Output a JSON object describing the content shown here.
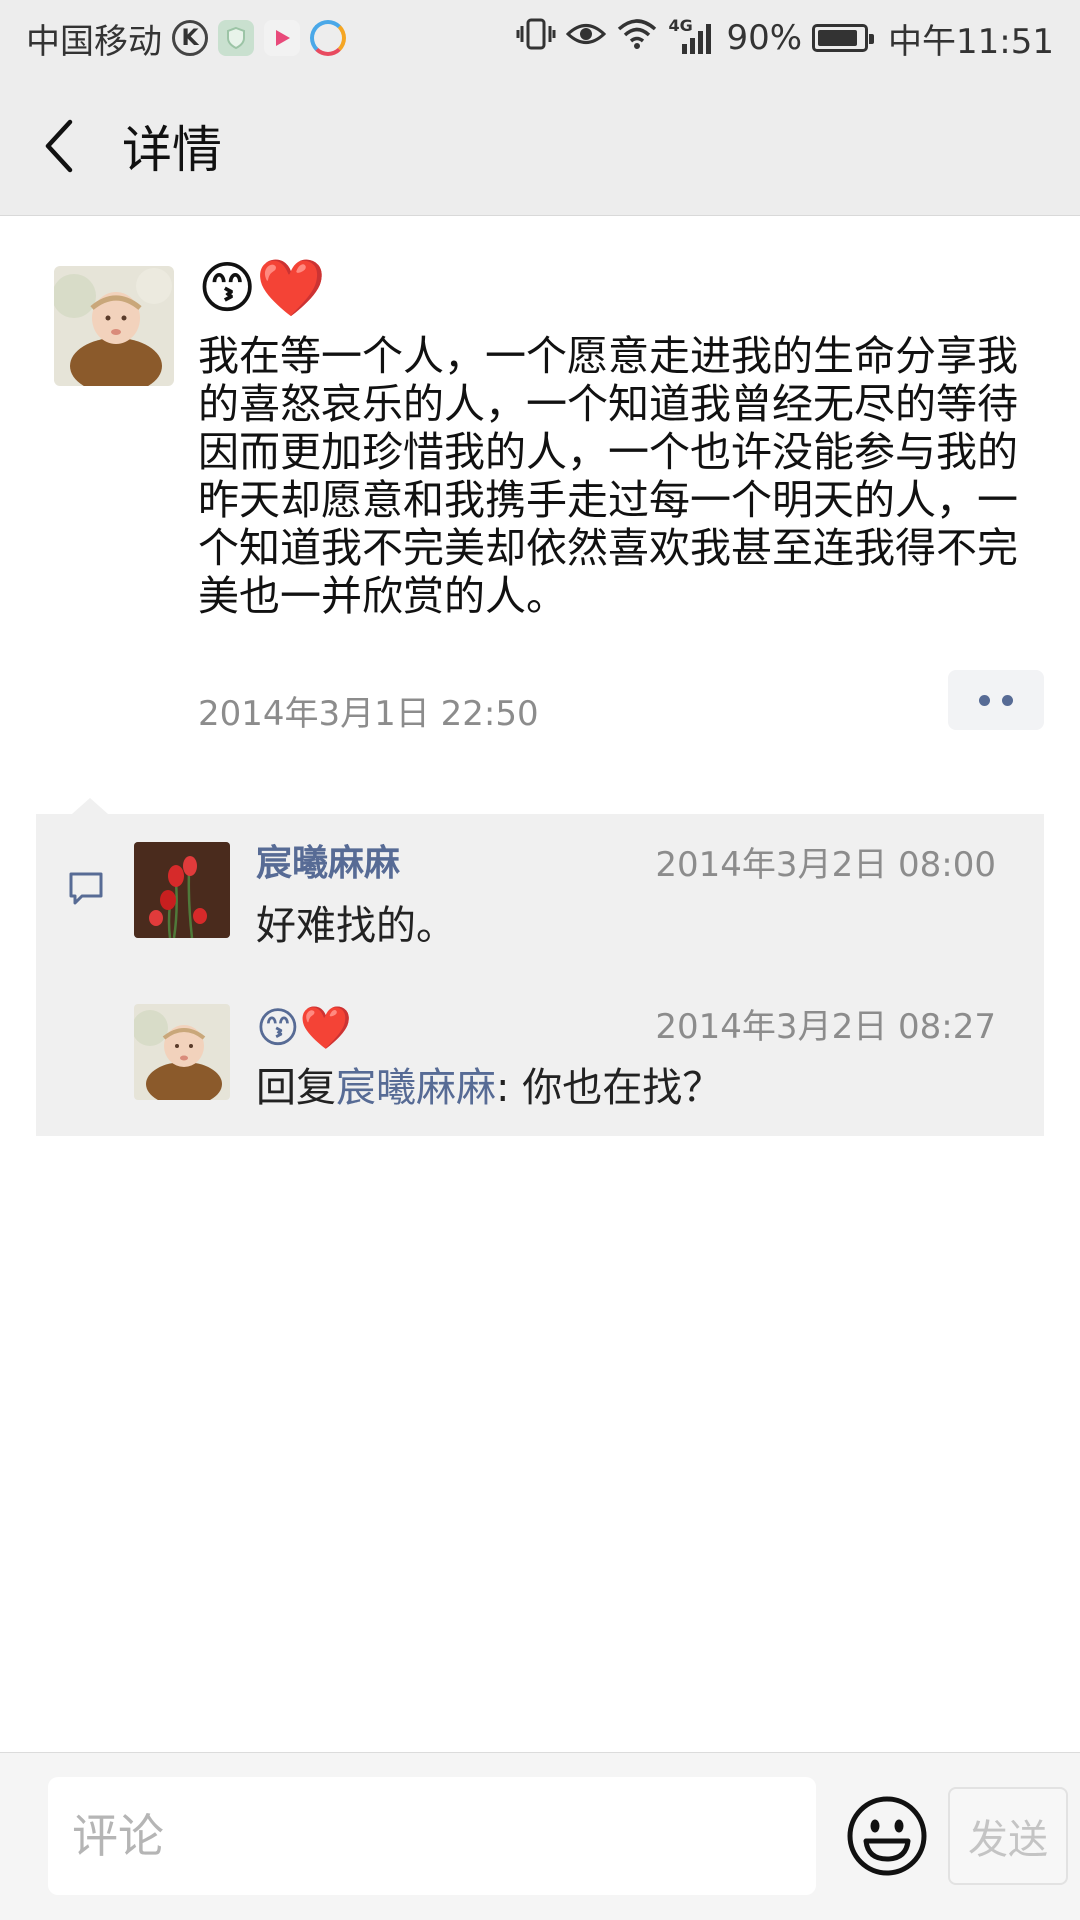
{
  "status_bar": {
    "carrier": "中国移动",
    "network": "4G",
    "battery": "90%",
    "battery_level": 0.9,
    "time": "中午11:51",
    "icons": [
      "k-app-icon",
      "shield-app-icon",
      "video-app-icon",
      "browser-app-icon",
      "vibrate-icon",
      "eye-icon",
      "wifi-icon",
      "signal-icon",
      "battery-icon"
    ]
  },
  "header": {
    "title": "详情",
    "back_icon": "chevron-left-icon"
  },
  "post": {
    "author_emoji": "😙❤️",
    "text": "我在等一个人，一个愿意走进我的生命分享我的喜怒哀乐的人，一个知道我曾经无尽的等待因而更加珍惜我的人，一个也许没能参与我的昨天却愿意和我携手走过每一个明天的人，一个知道我不完美却依然喜欢我甚至连我得不完美也一并欣赏的人。",
    "time": "2014年3月1日 22:50"
  },
  "comments": [
    {
      "name": "宸曦麻麻",
      "time": "2014年3月2日 08:00",
      "text": "好难找的。"
    },
    {
      "name": "😙❤️",
      "time": "2014年3月2日 08:27",
      "reply_prefix": "回复",
      "reply_to": "宸曦麻麻",
      "text": ": 你也在找？"
    }
  ],
  "bottom_bar": {
    "placeholder": "评论",
    "send_label": "发送"
  },
  "colors": {
    "link": "#576b95",
    "header_bg": "#ededed",
    "comment_bg": "#f0f0f0"
  }
}
